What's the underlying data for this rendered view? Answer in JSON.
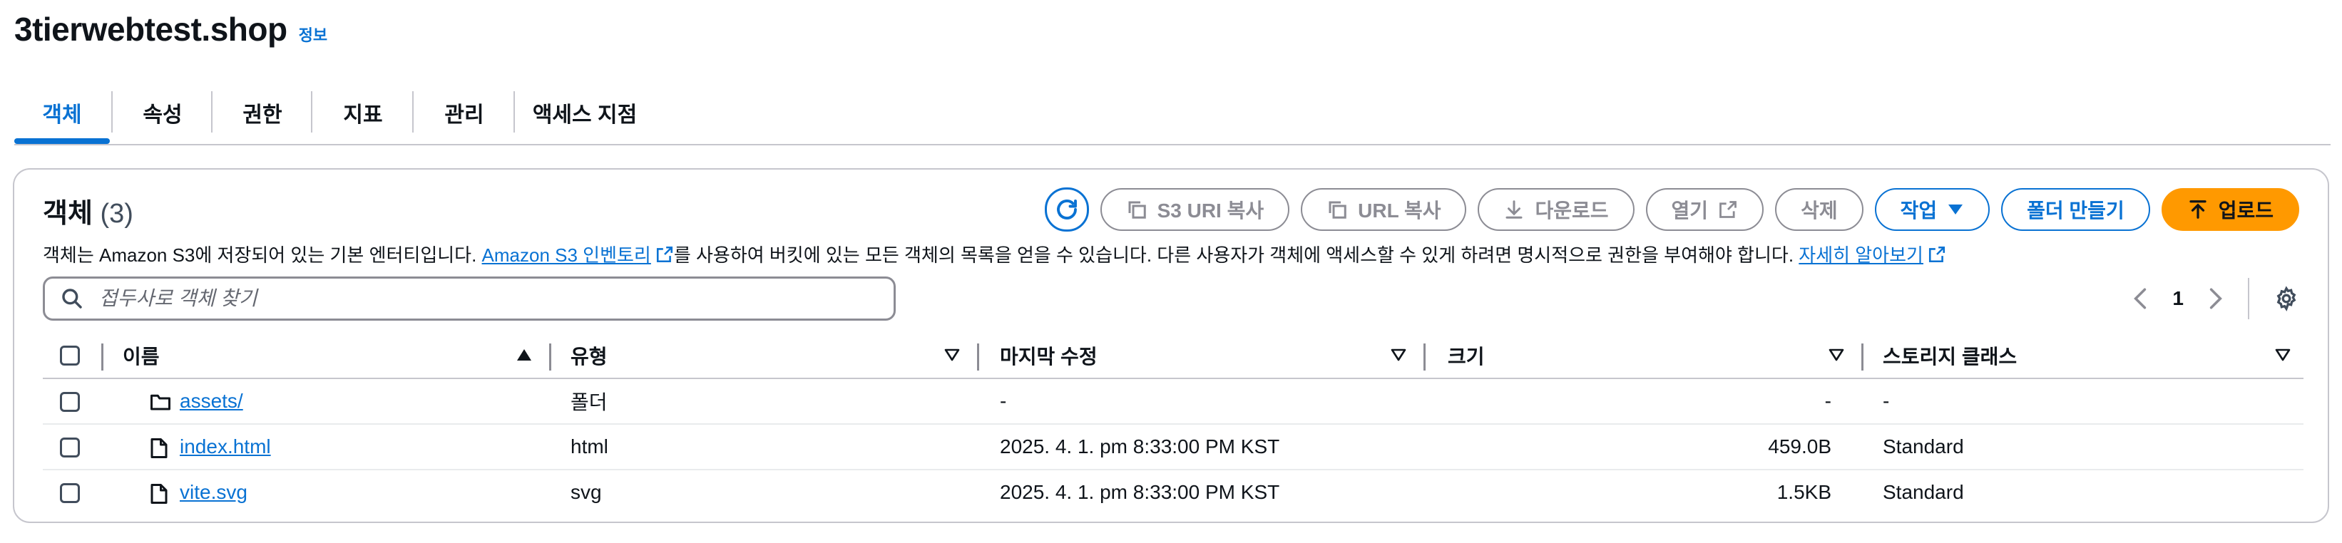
{
  "bucket": {
    "title": "3tierwebtest.shop",
    "info_label": "정보"
  },
  "tabs": [
    {
      "label": "객체",
      "active": true
    },
    {
      "label": "속성",
      "active": false
    },
    {
      "label": "권한",
      "active": false
    },
    {
      "label": "지표",
      "active": false
    },
    {
      "label": "관리",
      "active": false
    },
    {
      "label": "액세스 지점",
      "active": false
    }
  ],
  "objects": {
    "title": "객체",
    "count": "(3)",
    "toolbar": {
      "copy_s3_uri": "S3 URI 복사",
      "copy_url": "URL 복사",
      "download": "다운로드",
      "open": "열기",
      "delete": "삭제",
      "actions": "작업",
      "create_folder": "폴더 만들기",
      "upload": "업로드"
    },
    "description": {
      "part1": "객체는 Amazon S3에 저장되어 있는 기본 엔터티입니다. ",
      "inventory_link": "Amazon S3 인벤토리",
      "part2": "를 사용하여 버킷에 있는 모든 객체의 목록을 얻을 수 있습니다. 다른 사용자가 객체에 액세스할 수 있게 하려면 명시적으로 권한을 부여해야 합니다. ",
      "learn_more": "자세히 알아보기"
    },
    "search": {
      "placeholder": "접두사로 객체 찾기"
    },
    "pagination": {
      "current_page": "1"
    },
    "table": {
      "headers": {
        "name": "이름",
        "type": "유형",
        "last_modified": "마지막 수정",
        "size": "크기",
        "storage_class": "스토리지 클래스"
      },
      "rows": [
        {
          "name": "assets/",
          "icon": "folder-icon",
          "type": "폴더",
          "last_modified": "-",
          "size": "-",
          "storage_class": "-"
        },
        {
          "name": "index.html",
          "icon": "file-icon",
          "type": "html",
          "last_modified": "2025. 4. 1. pm 8:33:00 PM KST",
          "size": "459.0B",
          "storage_class": "Standard"
        },
        {
          "name": "vite.svg",
          "icon": "file-icon",
          "type": "svg",
          "last_modified": "2025. 4. 1. pm 8:33:00 PM KST",
          "size": "1.5KB",
          "storage_class": "Standard"
        }
      ]
    }
  },
  "colors": {
    "accent": "#0972d3",
    "upload": "#ff9900",
    "disabled": "#8c8c94"
  }
}
